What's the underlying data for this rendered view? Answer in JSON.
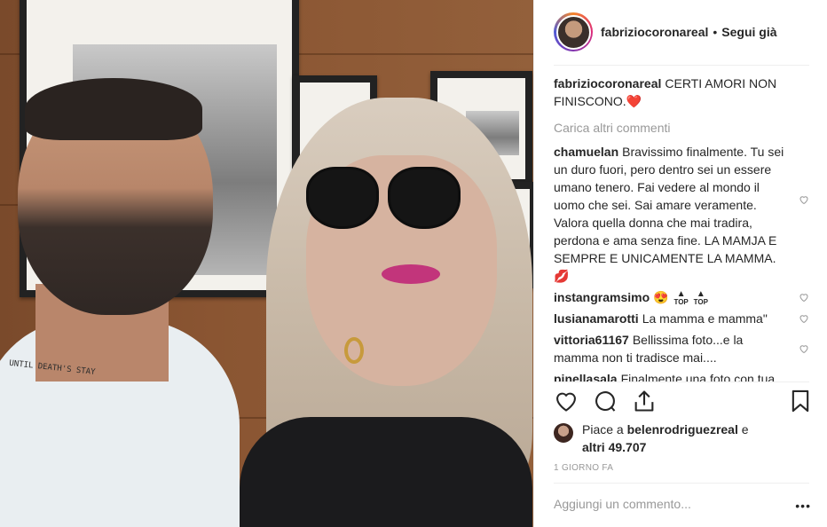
{
  "post": {
    "username": "fabriziocoronareal",
    "follow_status": "Segui già",
    "separator": "•",
    "caption_user": "fabriziocoronareal",
    "caption_text": "CERTI AMORI NON FINISCONO.",
    "caption_emoji": "❤️",
    "load_more": "Carica altri commenti"
  },
  "comments": [
    {
      "user": "chamuelan",
      "text": "Bravissimo finalmente. Tu sei un duro fuori, pero dentro sei un essere umano tenero. Fai vedere al mondo il uomo che sei. Sai amare veramente. Valora quella donna che mai tradira, perdona e ama senza fine. LA MAMJA E SEMPRE E UNICAMENTE LA MAMMA.",
      "emoji": "💋"
    },
    {
      "user": "instangramsimo",
      "text": "😍",
      "badge": "TOP"
    },
    {
      "user": "lusianamarotti",
      "text": "La mamma e mamma\""
    },
    {
      "user": "vittoria61167",
      "text": "Bellissima foto...e la mamma non ti tradisce mai...."
    },
    {
      "user": "pinellasala",
      "text": "Finalmente una foto con tua mamma... persona speciale"
    }
  ],
  "likes": {
    "prefix": "Piace a",
    "liker": "belenrodriguezreal",
    "conjunction": "e",
    "others": "altri 49.707"
  },
  "time_ago": "1 GIORNO FA",
  "add_comment_placeholder": "Aggiungi un commento...",
  "more_options": "•••",
  "photo": {
    "tattoo_text": "until death's stay"
  },
  "colors": {
    "text": "#262626",
    "muted": "#999999",
    "heart": "#ed4956",
    "border": "#efefef"
  },
  "icons": [
    "heart-icon",
    "comment-icon",
    "share-icon",
    "bookmark-icon",
    "small-heart-icon"
  ]
}
